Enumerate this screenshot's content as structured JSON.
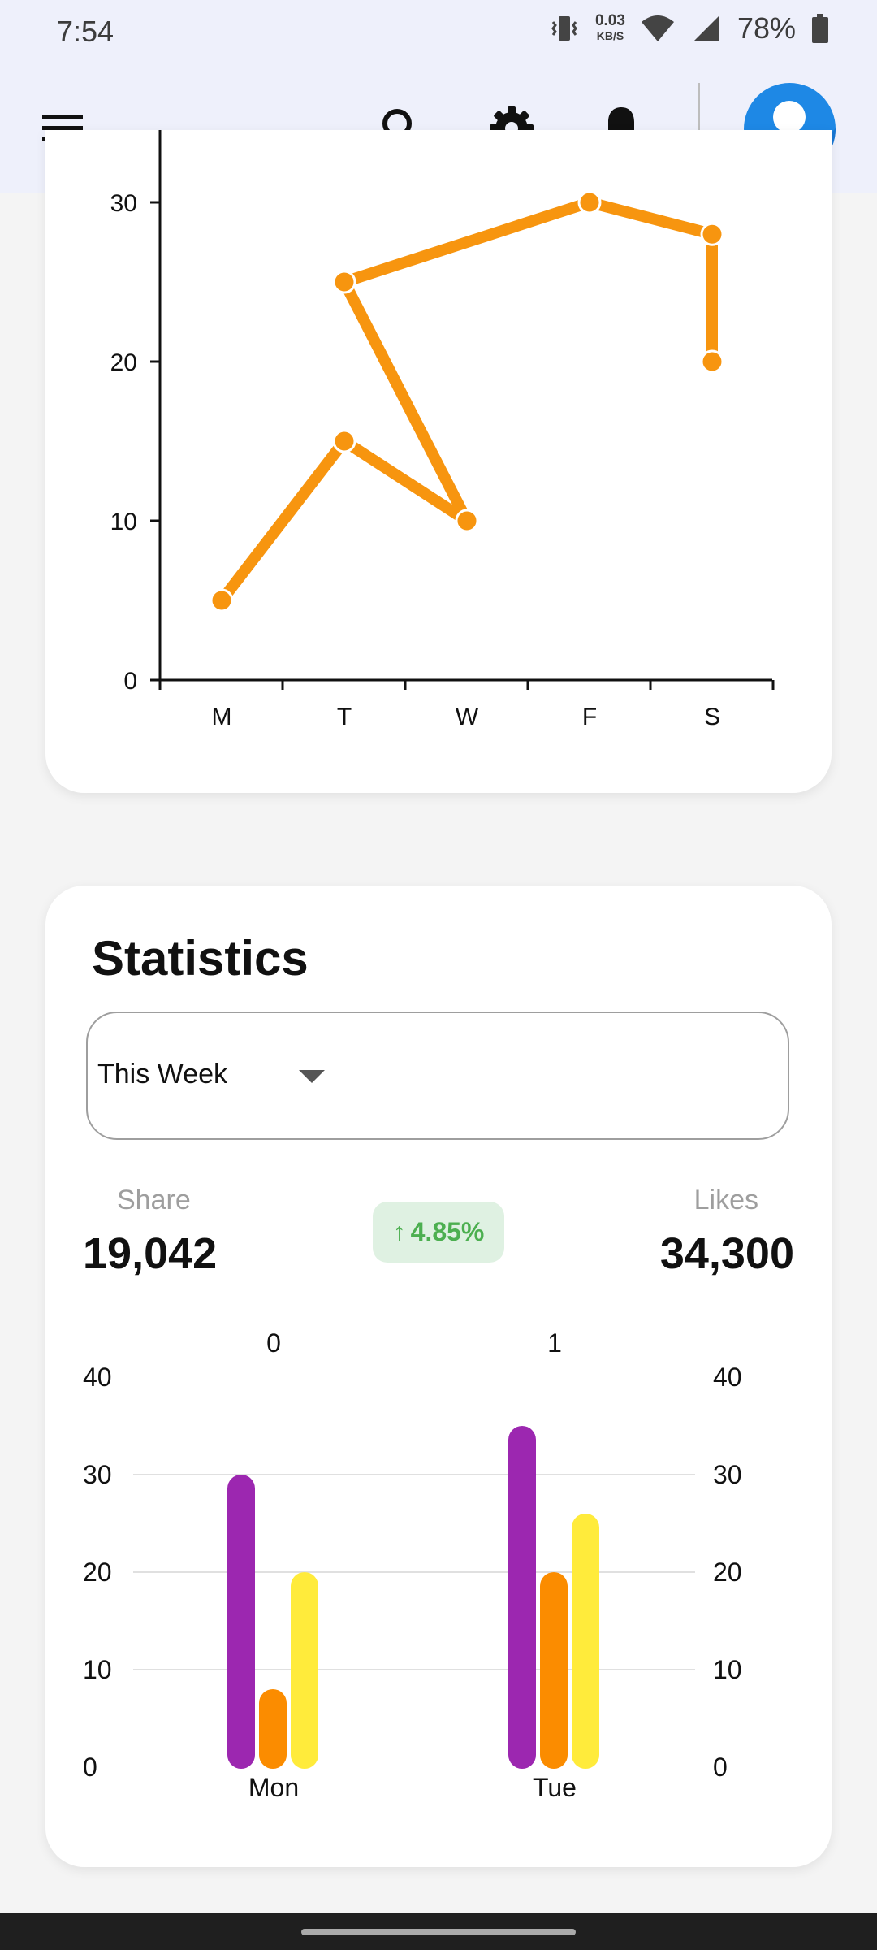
{
  "status_bar": {
    "time": "7:54",
    "net_speed_value": "0.03",
    "net_speed_unit": "KB/S",
    "battery": "78%"
  },
  "app_bar": {
    "icons": [
      "menu-icon",
      "search-icon",
      "gear-icon",
      "bell-icon",
      "avatar"
    ]
  },
  "line_chart": {
    "chart_data": {
      "type": "line",
      "x_ticks": [
        "M",
        "T",
        "W",
        "F",
        "S"
      ],
      "y_ticks": [
        "0",
        "10",
        "20",
        "30"
      ],
      "ylim": [
        0,
        30
      ],
      "points": [
        {
          "x": "M",
          "y": 5
        },
        {
          "x": "T",
          "y": 15
        },
        {
          "x": "W",
          "y": 10
        },
        {
          "x": "T",
          "y": 25
        },
        {
          "x": "F",
          "y": 30
        },
        {
          "x": "S",
          "y": 28
        },
        {
          "x": "S",
          "y": 20
        }
      ],
      "color": "#f7950f"
    }
  },
  "statistics": {
    "title": "Statistics",
    "period": "This Week",
    "share_label": "Share",
    "share_value": "19,042",
    "change": "4.85%",
    "change_arrow": "↑",
    "likes_label": "Likes",
    "likes_value": "34,300"
  },
  "chart_data": {
    "type": "bar",
    "categories": [
      "Mon",
      "Tue"
    ],
    "top_labels": [
      "0",
      "1"
    ],
    "y_ticks": [
      "0",
      "10",
      "20",
      "30",
      "40"
    ],
    "ylim": [
      0,
      40
    ],
    "series": [
      {
        "values": [
          30,
          35
        ],
        "color": "#9c27b0"
      },
      {
        "values": [
          8,
          20
        ],
        "color": "#fb8c00"
      },
      {
        "values": [
          20,
          26
        ],
        "color": "#ffeb3b"
      }
    ],
    "grid": true
  }
}
